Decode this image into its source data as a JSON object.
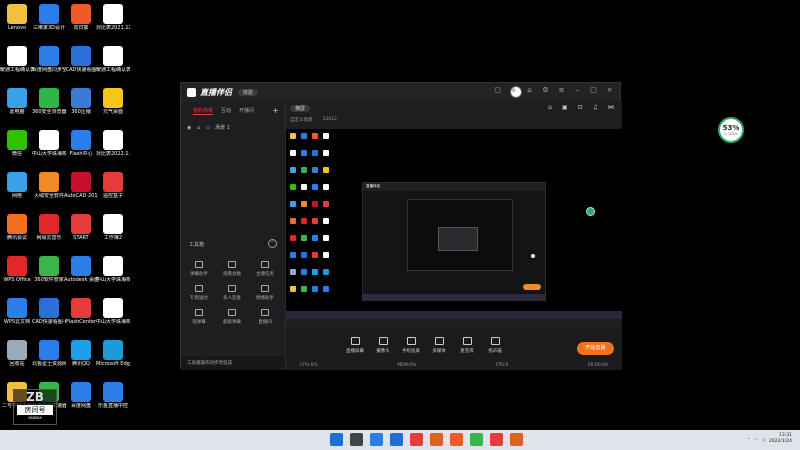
{
  "desktop_icons": [
    {
      "label": "Lenovo",
      "color": "#f0c040"
    },
    {
      "label": "三维家3D设计",
      "color": "#2b7de9"
    },
    {
      "label": "向日葵",
      "color": "#f05a28"
    },
    {
      "label": "对比表2021.12.27",
      "color": "#ffffff"
    },
    {
      "label": "暖通工程确认表",
      "color": "#ffffff"
    },
    {
      "label": "百度网盘同步空间",
      "color": "#2b7de9"
    },
    {
      "label": "CAD快速看图",
      "color": "#2b6fd9"
    },
    {
      "label": "暖通工程确认表",
      "color": "#ffffff"
    },
    {
      "label": "此电脑",
      "color": "#3aa0e8"
    },
    {
      "label": "360安全浏览器",
      "color": "#2fb54a"
    },
    {
      "label": "360压缩",
      "color": "#3a7bd5"
    },
    {
      "label": "元气桌面",
      "color": "#f5c518"
    },
    {
      "label": "微信",
      "color": "#2dc100"
    },
    {
      "label": "中山大学珠海校区二号学",
      "color": "#ffffff"
    },
    {
      "label": "Flash中心",
      "color": "#2b7de9"
    },
    {
      "label": "对比表2022.1.22",
      "color": "#ffffff"
    },
    {
      "label": "网络",
      "color": "#3aa0e8"
    },
    {
      "label": "火绒安全软件",
      "color": "#f08a24"
    },
    {
      "label": "AutoCAD 2018 - 简体",
      "color": "#c8102e"
    },
    {
      "label": "遥控盒子",
      "color": "#e63b3b"
    },
    {
      "label": "腾讯会议",
      "color": "#f07020"
    },
    {
      "label": "网易云音乐",
      "color": "#e02828"
    },
    {
      "label": "START",
      "color": "#e63b3b"
    },
    {
      "label": "工作簿2",
      "color": "#ffffff"
    },
    {
      "label": "WPS Office",
      "color": "#e02828"
    },
    {
      "label": "360软件管家",
      "color": "#3ab54a"
    },
    {
      "label": "Autodesk 桌面应用程序",
      "color": "#2b7de9"
    },
    {
      "label": "中山大学珠海校区二号学",
      "color": "#ffffff"
    },
    {
      "label": "WPS云文档",
      "color": "#2b7de9"
    },
    {
      "label": "CAD快速看图-编辑",
      "color": "#2b6fd9"
    },
    {
      "label": "FlashCenter",
      "color": "#e63b3b"
    },
    {
      "label": "中山大学珠海校区二号学",
      "color": "#ffffff"
    },
    {
      "label": "回收站",
      "color": "#9ab"
    },
    {
      "label": "北极星士资源网",
      "color": "#2b7de9"
    },
    {
      "label": "腾讯QQ",
      "color": "#1ea0e8"
    },
    {
      "label": "Microsoft Edge",
      "color": "#1b9bd8"
    },
    {
      "label": "二号学院工程",
      "color": "#f0c040"
    },
    {
      "label": "北京快乐加速器",
      "color": "#3ab54a"
    },
    {
      "label": "百度网盘",
      "color": "#2b7de9"
    },
    {
      "label": "乐鱼直播中控",
      "color": "#2b7de9"
    }
  ],
  "live_window": {
    "title": "直播伴侣",
    "badge": "体验",
    "tabs": [
      "我的场景",
      "互动",
      "开播间"
    ],
    "scene_name": "场景 1",
    "toolbox_title": "工具箱",
    "tools": [
      "弹幕助手",
      "观看总数",
      "主播任务",
      "礼物送达",
      "多人连麦",
      "情绪助手",
      "观弹幕",
      "超级弹幕",
      "直播间"
    ],
    "bottom_note": "工具箱操作同步改造成",
    "preview_tag": "横屏",
    "preview_info_left": "自定义场景",
    "preview_info_right": "33612",
    "bottom_tools": [
      "直播屏幕",
      "摄像头",
      "手机投屏",
      "多媒体",
      "麦克风",
      "扬声器"
    ],
    "go_live_label": "开始直播",
    "status_left": "CPU:0%",
    "status_mid1": "MEM:0%",
    "status_mid2": "FPS:0",
    "status_right": "00:00:00"
  },
  "net_widget": {
    "percent": "53%",
    "speed": "0.1KB/s"
  },
  "watermark": {
    "top": "ZB",
    "middle": "房间号",
    "bottom": "888888"
  },
  "taskbar": {
    "time": "13:31",
    "date": "2022/1/24",
    "apps_colors": [
      "#1f6fd6",
      "#444",
      "#2b7de9",
      "#1f6fd6",
      "#e63b3b",
      "#e06020",
      "#f05a28",
      "#3ab54a",
      "#e63b3b",
      "#e06020"
    ]
  }
}
